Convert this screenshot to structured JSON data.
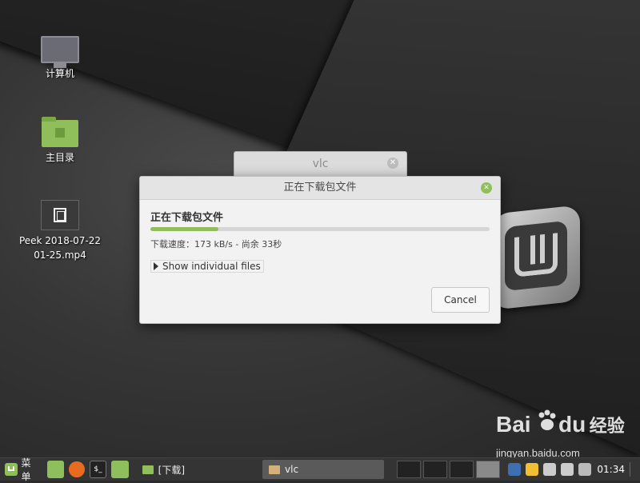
{
  "desktop": {
    "icons": [
      {
        "label": "计算机"
      },
      {
        "label": "主目录"
      },
      {
        "label": "Peek 2018-07-22 01-25.mp4"
      }
    ]
  },
  "vlc_window": {
    "title": "vlc"
  },
  "dialog": {
    "title": "正在下载包文件",
    "heading": "正在下载包文件",
    "progress_fraction": 0.2,
    "status": "下载速度：173 kB/s - 尚余 33秒",
    "expander_label": "Show individual files",
    "cancel_label": "Cancel"
  },
  "taskbar": {
    "menu_label": "菜单",
    "tasks": [
      {
        "label": "[下载]"
      },
      {
        "label": "vlc"
      }
    ],
    "clock": "01:34"
  },
  "watermark": {
    "brand": "Bai",
    "brand_suffix": "du",
    "brand_cn": "经验",
    "url": "jingyan.baidu.com"
  },
  "colors": {
    "accent": "#8fbf5a",
    "dialog_bg": "#f2f2f2",
    "taskbar_bg": "#343434"
  }
}
